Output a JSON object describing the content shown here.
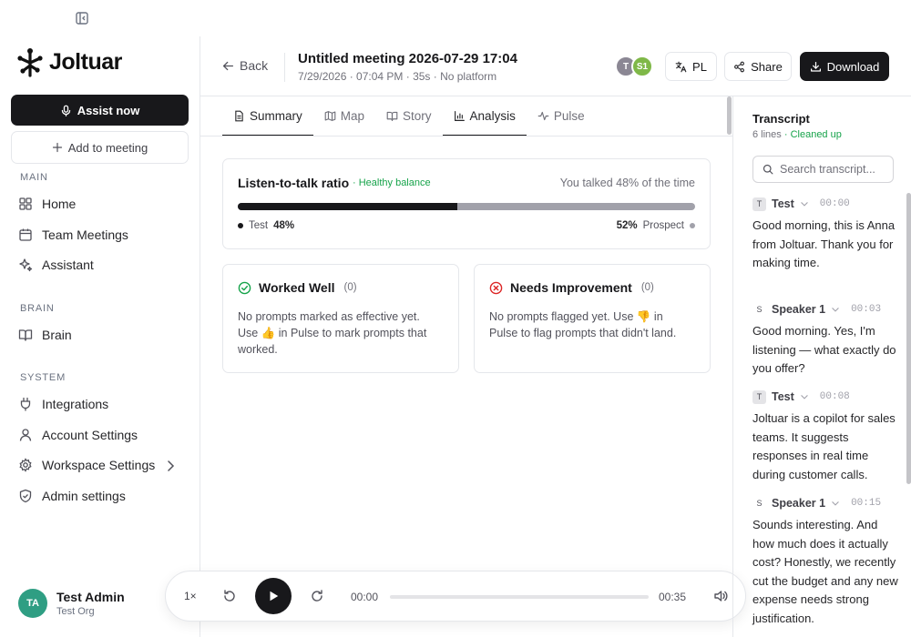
{
  "brand": {
    "name": "Joltuar"
  },
  "sidebar": {
    "assist_label": "Assist now",
    "add_label": "Add to meeting",
    "sections": {
      "main": "MAIN",
      "brain": "BRAIN",
      "system": "SYSTEM"
    },
    "items": {
      "home": "Home",
      "team_meetings": "Team Meetings",
      "assistant": "Assistant",
      "brain": "Brain",
      "integrations": "Integrations",
      "account_settings": "Account Settings",
      "workspace_settings": "Workspace Settings",
      "admin_settings": "Admin settings"
    },
    "user": {
      "initials": "TA",
      "name": "Test Admin",
      "org": "Test Org"
    }
  },
  "header": {
    "back_label": "Back",
    "title": "Untitled meeting 2026-07-29 17:04",
    "subtitle": "7/29/2026 · 07:04 PM · 35s · No platform",
    "participants": [
      "T",
      "S1"
    ],
    "language_label": "PL",
    "share_label": "Share",
    "download_label": "Download"
  },
  "tabs": [
    "Summary",
    "Map",
    "Story",
    "Analysis",
    "Pulse"
  ],
  "active_tab": "Analysis",
  "talk_ratio": {
    "title": "Listen-to-talk ratio",
    "badge": "· Healthy balance",
    "summary": "You talked 48% of the time",
    "you_label": "Test",
    "you_pct": "48%",
    "you_fraction": 0.48,
    "other_label": "Prospect",
    "other_pct": "52%"
  },
  "worked_well": {
    "title": "Worked Well",
    "count": "(0)",
    "body": "No prompts marked as effective yet. Use 👍 in Pulse to mark prompts that worked."
  },
  "needs_improvement": {
    "title": "Needs Improvement",
    "count": "(0)",
    "body": "No prompts flagged yet. Use 👎 in Pulse to flag prompts that didn't land."
  },
  "player": {
    "speed": "1×",
    "current_time": "00:00",
    "duration": "00:35",
    "progress": 0
  },
  "transcript": {
    "title": "Transcript",
    "lines_label": "6 lines",
    "status": "· Cleaned up",
    "search_placeholder": "Search transcript...",
    "messages": [
      {
        "badge": "T",
        "speaker": "Test",
        "time": "00:00",
        "text": "Good morning, this is Anna from Joltuar. Thank you for making time."
      },
      {
        "badge": "S",
        "speaker": "Speaker 1",
        "time": "00:03",
        "text": "Good morning. Yes, I'm listening — what exactly do you offer?"
      },
      {
        "badge": "T",
        "speaker": "Test",
        "time": "00:08",
        "text": "Joltuar is a copilot for sales teams. It suggests responses in real time during customer calls."
      },
      {
        "badge": "S",
        "speaker": "Speaker 1",
        "time": "00:15",
        "text": "Sounds interesting. And how much does it actually cost? Honestly, we recently cut the budget and any new expense needs strong justification."
      }
    ]
  },
  "colors": {
    "primary": "#18181b",
    "success": "#16a34a",
    "danger": "#dc2626",
    "avatar_admin": "#2f9e83",
    "avatar_t": "#8b8794",
    "avatar_s1": "#7fb848"
  }
}
